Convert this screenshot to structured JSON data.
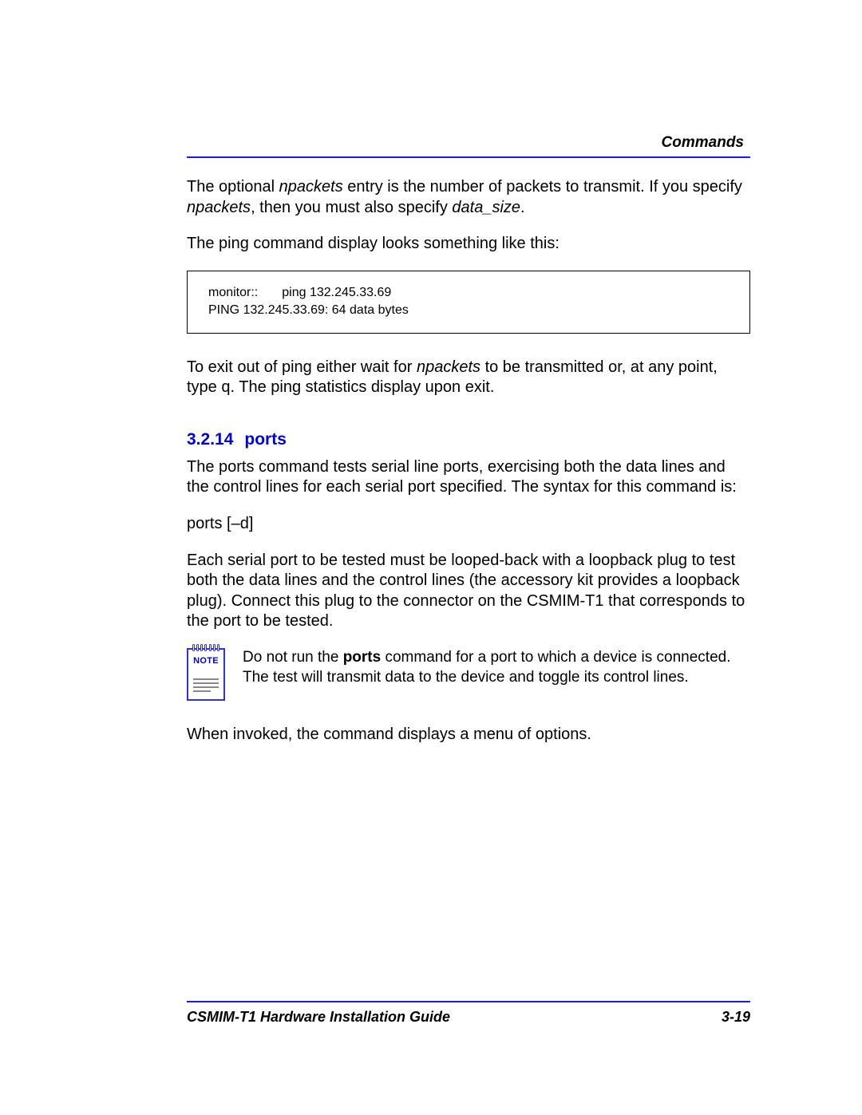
{
  "header": {
    "title": "Commands"
  },
  "paragraphs": {
    "p1_part1": "The optional ",
    "p1_npackets": "npackets",
    "p1_part2": " entry is the number of packets to transmit.  If you specify ",
    "p1_npackets2": "npackets",
    "p1_part3": ", then you must also specify ",
    "p1_datasize": "data_size",
    "p1_part4": ".",
    "p2_part1": "The ",
    "p2_ping": "ping",
    "p2_part2": " command display looks something like this:",
    "p3_part1": "To exit out of ",
    "p3_ping": "ping",
    "p3_part2": " either wait for ",
    "p3_npackets": "npackets",
    "p3_part3": " to be transmitted or, at any point, type ",
    "p3_q": "q",
    "p3_part4": ". The ",
    "p3_ping2": "ping",
    "p3_part5": " statistics display upon exit.",
    "p4": "The ports command tests serial line ports, exercising both the data lines and the control lines for each serial port speciﬁed. The syntax for this command is:",
    "p5": "ports [–d]",
    "p6": "Each serial port to be tested must be looped-back with a loopback plug to test both the data lines and the control lines (the accessory kit provides a loopback plug). Connect this plug to the connector on the CSMIM-T1 that corresponds to the port to be tested.",
    "p7": "When invoked, the command displays a menu of options."
  },
  "codebox": {
    "line1_col1": "monitor::",
    "line1_col2": "ping 132.245.33.69",
    "line2": "PING 132.245.33.69: 64 data bytes"
  },
  "section": {
    "num": "3.2.14",
    "title": "ports"
  },
  "note": {
    "label": "NOTE",
    "text_part1": "Do not run the ",
    "text_bold": "ports",
    "text_part2": " command for a port to which a device is connected. The test will transmit data to the device and toggle its control lines."
  },
  "footer": {
    "left": "CSMIM-T1 Hardware Installation Guide",
    "right": "3-19"
  }
}
